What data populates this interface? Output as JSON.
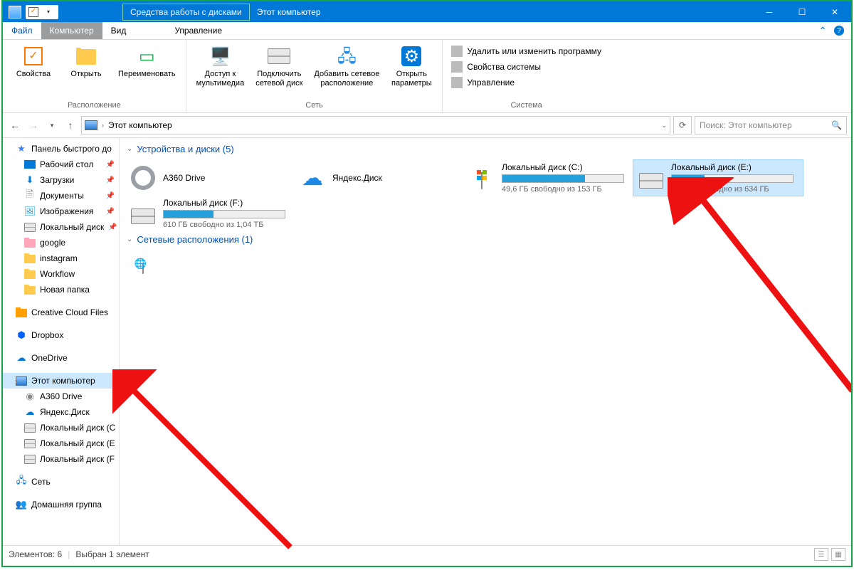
{
  "title": {
    "context": "Средства работы с дисками",
    "main": "Этот компьютер"
  },
  "tabs": {
    "file": "Файл",
    "computer": "Компьютер",
    "view": "Вид",
    "manage": "Управление"
  },
  "ribbon": {
    "location_group": "Расположение",
    "network_group": "Сеть",
    "system_group": "Система",
    "properties": "Свойства",
    "open": "Открыть",
    "rename": "Переименовать",
    "media": "Доступ к\nмультимедиа",
    "map": "Подключить\nсетевой диск",
    "addnet": "Добавить сетевое\nрасположение",
    "netparams": "Открыть\nпараметры",
    "sys1": "Удалить или изменить программу",
    "sys2": "Свойства системы",
    "sys3": "Управление"
  },
  "nav": {
    "path": "Этот компьютер",
    "search_placeholder": "Поиск: Этот компьютер"
  },
  "sidebar": {
    "quick": "Панель быстрого до",
    "desktop": "Рабочий стол",
    "downloads": "Загрузки",
    "documents": "Документы",
    "pictures": "Изображения",
    "localdisk": "Локальный диск",
    "google": "google",
    "instagram": "instagram",
    "workflow": "Workflow",
    "newfolder": "Новая папка",
    "ccf": "Creative Cloud Files",
    "dropbox": "Dropbox",
    "onedrive": "OneDrive",
    "thispc": "Этот компьютер",
    "a360": "A360 Drive",
    "yandex": "Яндекс.Диск",
    "ldc": "Локальный диск (C",
    "lde": "Локальный диск (E",
    "ldf": "Локальный диск (F",
    "network": "Сеть",
    "homegroup": "Домашняя группа"
  },
  "content": {
    "devices_hdr": "Устройства и диски (5)",
    "network_hdr": "Сетевые расположения (1)",
    "a360": "A360 Drive",
    "yandex": "Яндекс.Диск",
    "drive_c": {
      "name": "Локальный диск (C:)",
      "stat": "49,6 ГБ свободно из 153 ГБ",
      "fill": 68
    },
    "drive_e": {
      "name": "Локальный диск (E:)",
      "stat": "465 ГБ свободно из 634 ГБ",
      "fill": 27
    },
    "drive_f": {
      "name": "Локальный диск (F:)",
      "stat": "610 ГБ свободно из 1,04 ТБ",
      "fill": 41
    }
  },
  "status": {
    "count": "Элементов: 6",
    "sel": "Выбран 1 элемент"
  }
}
